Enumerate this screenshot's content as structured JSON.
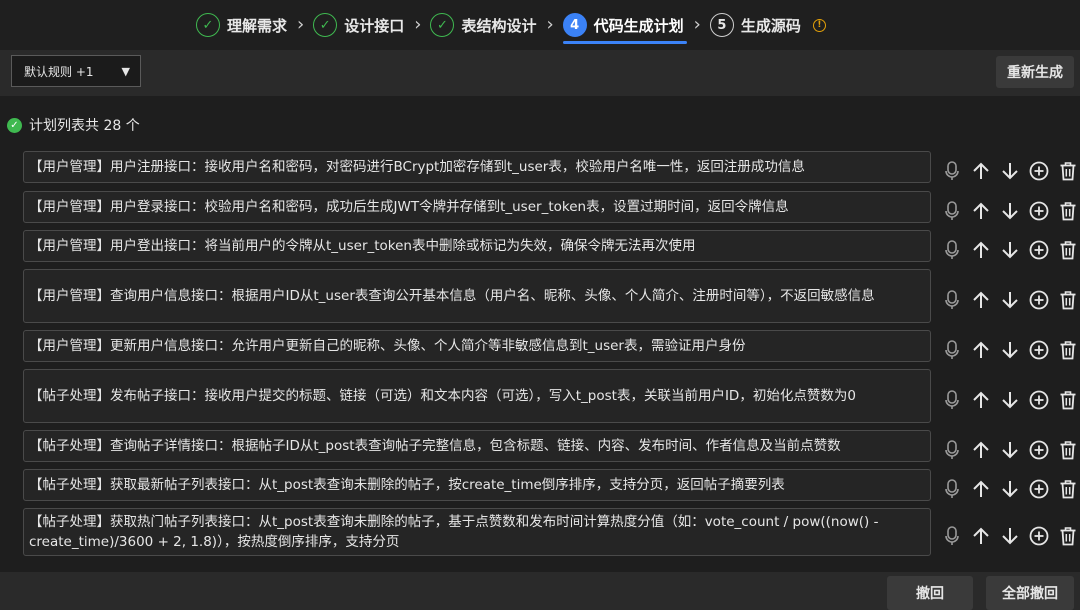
{
  "steps": [
    {
      "label": "理解需求",
      "status": "done",
      "marker": "✓"
    },
    {
      "label": "设计接口",
      "status": "done",
      "marker": "✓"
    },
    {
      "label": "表结构设计",
      "status": "done",
      "marker": "✓"
    },
    {
      "label": "代码生成计划",
      "status": "active",
      "marker": "4"
    },
    {
      "label": "生成源码",
      "status": "pending",
      "marker": "5"
    }
  ],
  "separator": "›",
  "warn_glyph": "!",
  "toolbar": {
    "rule_select_value": "默认规则 +1",
    "regenerate_label": "重新生成"
  },
  "plan_count_text": "计划列表共 28 个",
  "plans": [
    {
      "text": "【用户管理】用户注册接口：接收用户名和密码，对密码进行BCrypt加密存储到t_user表，校验用户名唯一性，返回注册成功信息"
    },
    {
      "text": "【用户管理】用户登录接口：校验用户名和密码，成功后生成JWT令牌并存储到t_user_token表，设置过期时间，返回令牌信息"
    },
    {
      "text": "【用户管理】用户登出接口：将当前用户的令牌从t_user_token表中删除或标记为失效，确保令牌无法再次使用"
    },
    {
      "text": "【用户管理】查询用户信息接口：根据用户ID从t_user表查询公开基本信息（用户名、昵称、头像、个人简介、注册时间等），不返回敏感信息"
    },
    {
      "text": "【用户管理】更新用户信息接口：允许用户更新自己的昵称、头像、个人简介等非敏感信息到t_user表，需验证用户身份"
    },
    {
      "text": "【帖子处理】发布帖子接口：接收用户提交的标题、链接（可选）和文本内容（可选），写入t_post表，关联当前用户ID，初始化点赞数为0"
    },
    {
      "text": "【帖子处理】查询帖子详情接口：根据帖子ID从t_post表查询帖子完整信息，包含标题、链接、内容、发布时间、作者信息及当前点赞数"
    },
    {
      "text": "【帖子处理】获取最新帖子列表接口：从t_post表查询未删除的帖子，按create_time倒序排序，支持分页，返回帖子摘要列表"
    },
    {
      "text": "【帖子处理】获取热门帖子列表接口：从t_post表查询未删除的帖子，基于点赞数和发布时间计算热度分值（如：vote_count / pow((now() - create_time)/3600 + 2, 1.8)），按热度倒序排序，支持分页"
    }
  ],
  "icons": [
    "mic-icon",
    "arrow-up-icon",
    "arrow-down-icon",
    "add-circle-icon",
    "trash-icon"
  ],
  "footer": {
    "undo_label": "撤回",
    "undo_all_label": "全部撤回"
  },
  "colors": {
    "accent": "#3b82f6",
    "success": "#3fb950",
    "warning": "#e3a008"
  }
}
